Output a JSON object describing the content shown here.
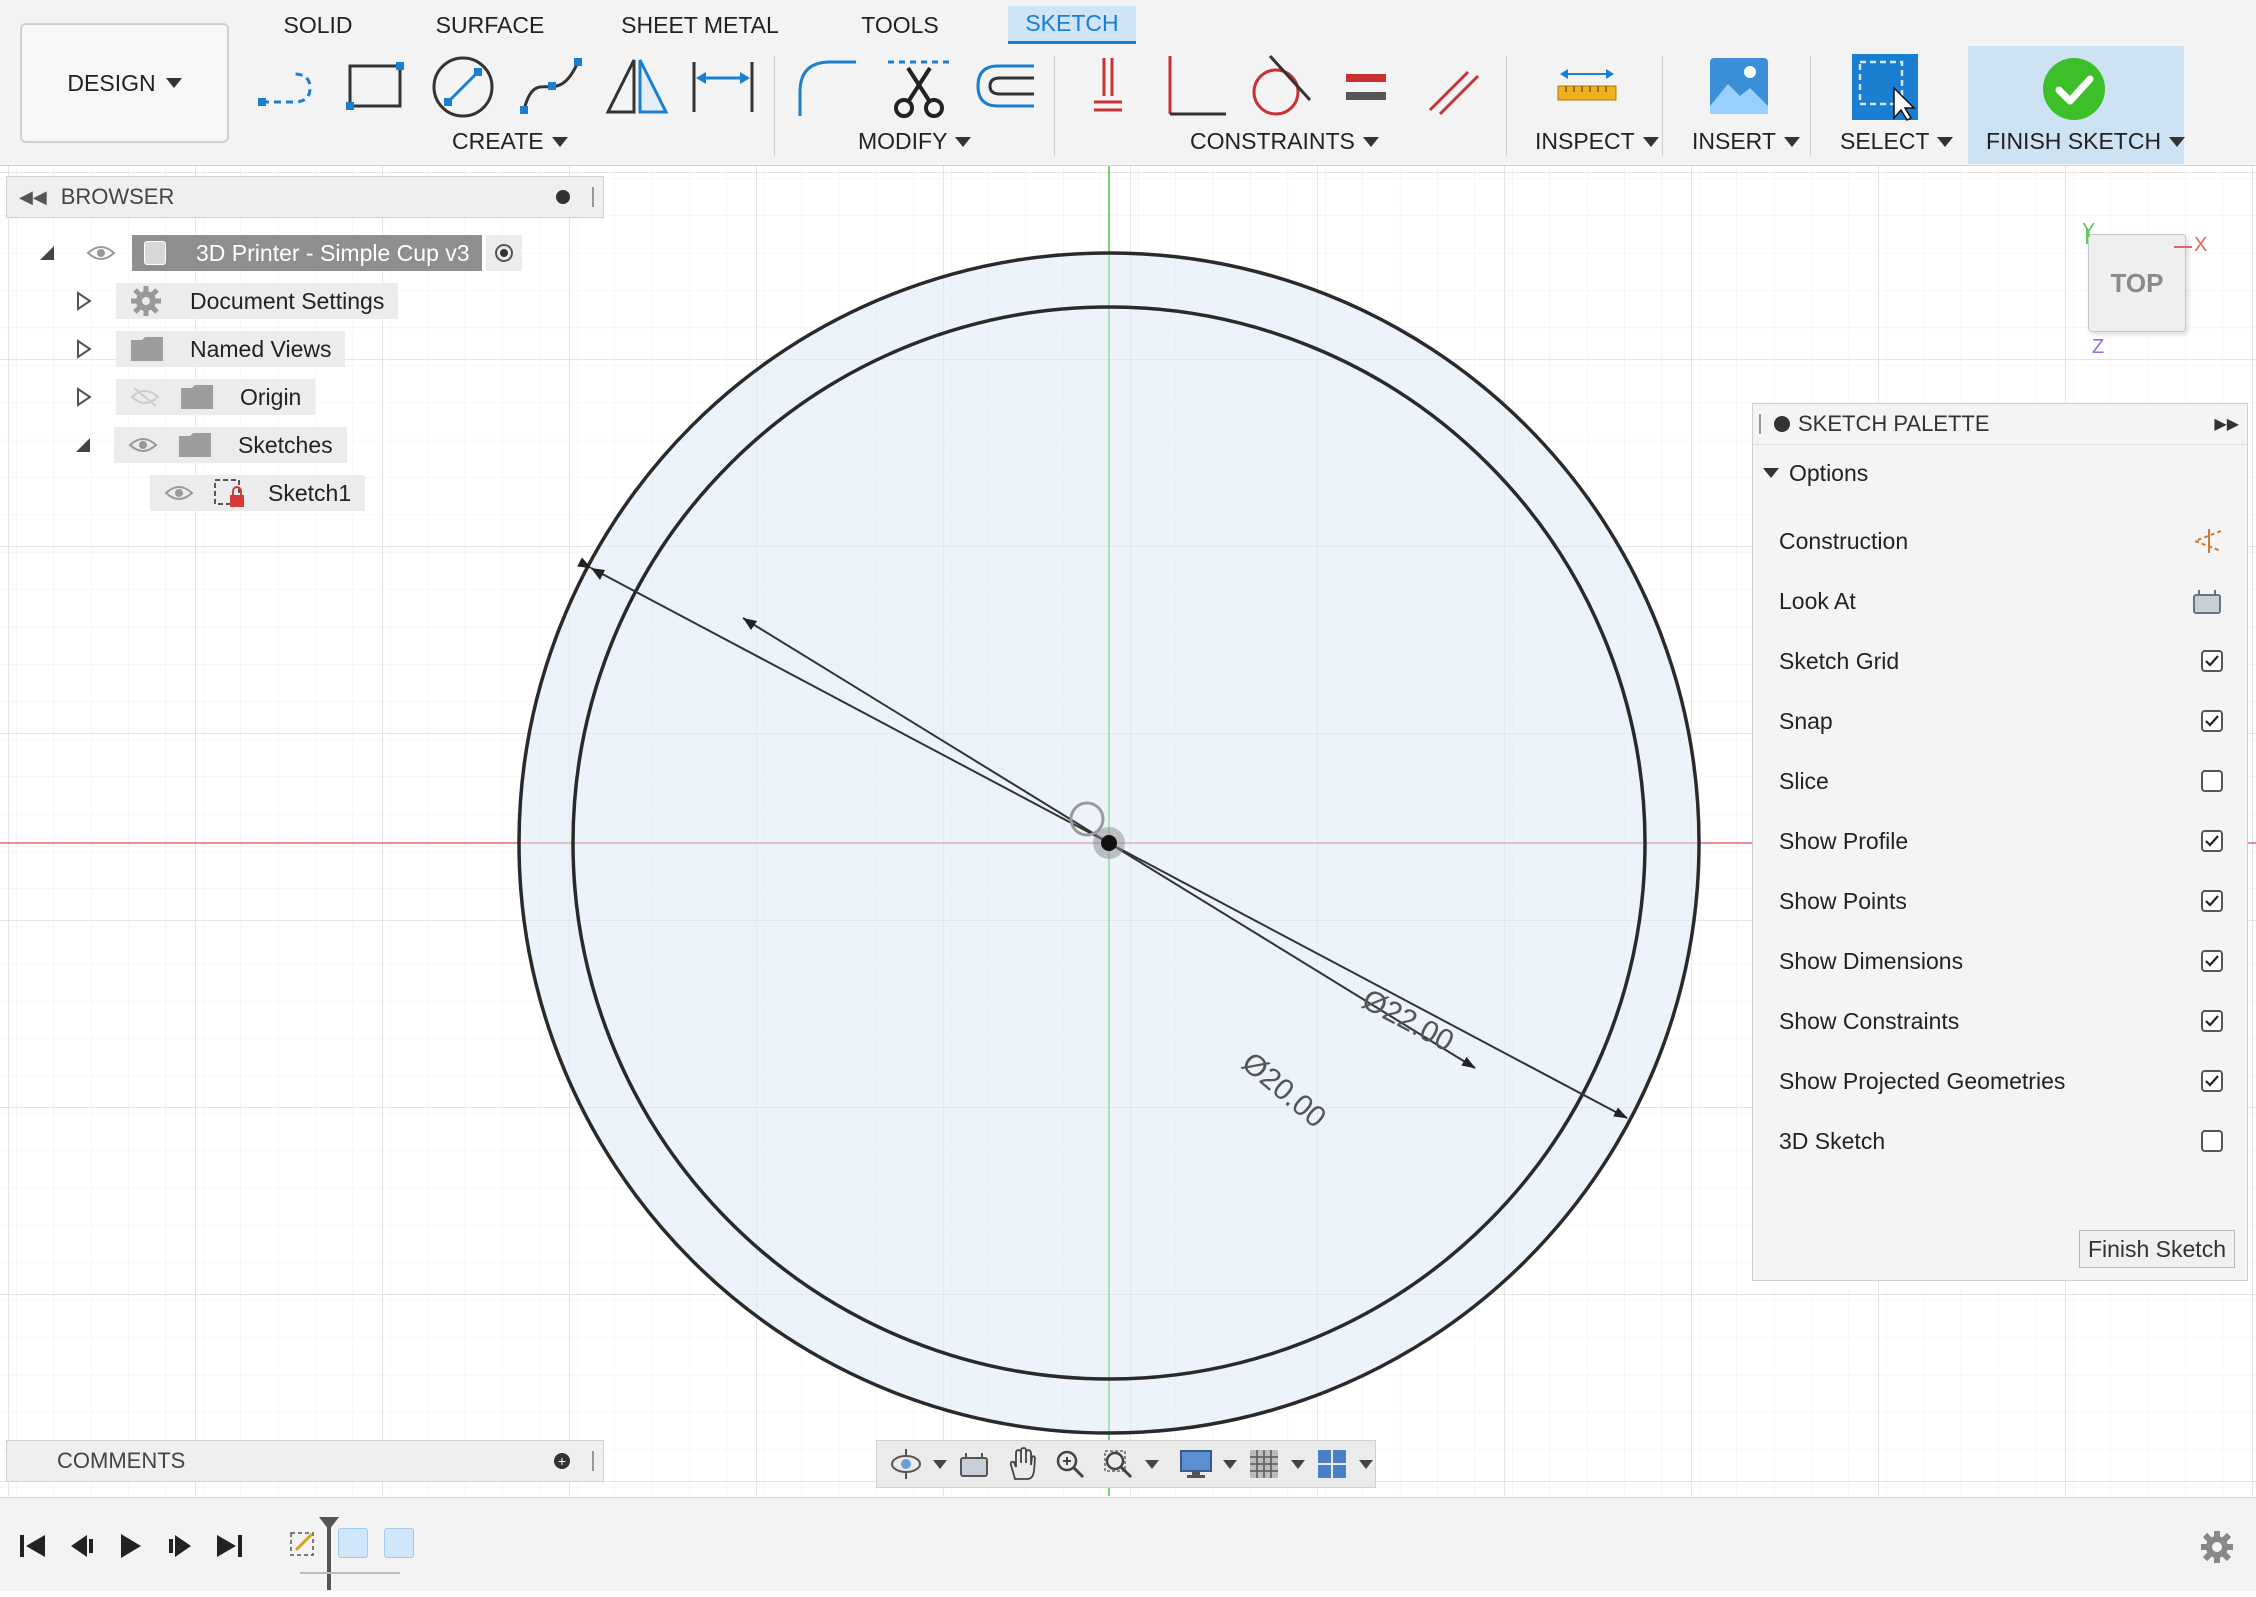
{
  "toolbar": {
    "workspace": "DESIGN",
    "tabs": [
      "SOLID",
      "SURFACE",
      "SHEET METAL",
      "TOOLS",
      "SKETCH"
    ],
    "active_tab": "SKETCH",
    "groups": [
      "CREATE",
      "MODIFY",
      "CONSTRAINTS",
      "INSPECT",
      "INSERT",
      "SELECT",
      "FINISH SKETCH"
    ],
    "accent": "#1a7fd0"
  },
  "browser": {
    "title": "BROWSER",
    "root": "3D Printer - Simple Cup v3",
    "items": [
      "Document Settings",
      "Named Views",
      "Origin",
      "Sketches"
    ],
    "sketch": "Sketch1"
  },
  "comments": {
    "title": "COMMENTS"
  },
  "viewcube": {
    "face": "TOP",
    "axis_x": "X",
    "axis_y": "Y",
    "axis_z": "Z"
  },
  "sketch": {
    "outer_dimension": "Ø22.00",
    "inner_dimension": "Ø20.00"
  },
  "palette": {
    "title": "SKETCH PALETTE",
    "section": "Options",
    "options": [
      {
        "label": "Construction",
        "type": "icon"
      },
      {
        "label": "Look At",
        "type": "icon"
      },
      {
        "label": "Sketch Grid",
        "type": "checkbox",
        "checked": true
      },
      {
        "label": "Snap",
        "type": "checkbox",
        "checked": true
      },
      {
        "label": "Slice",
        "type": "checkbox",
        "checked": false
      },
      {
        "label": "Show Profile",
        "type": "checkbox",
        "checked": true
      },
      {
        "label": "Show Points",
        "type": "checkbox",
        "checked": true
      },
      {
        "label": "Show Dimensions",
        "type": "checkbox",
        "checked": true
      },
      {
        "label": "Show Constraints",
        "type": "checkbox",
        "checked": true
      },
      {
        "label": "Show Projected Geometries",
        "type": "checkbox",
        "checked": true
      },
      {
        "label": "3D Sketch",
        "type": "checkbox",
        "checked": false
      }
    ],
    "finish_button": "Finish Sketch"
  }
}
